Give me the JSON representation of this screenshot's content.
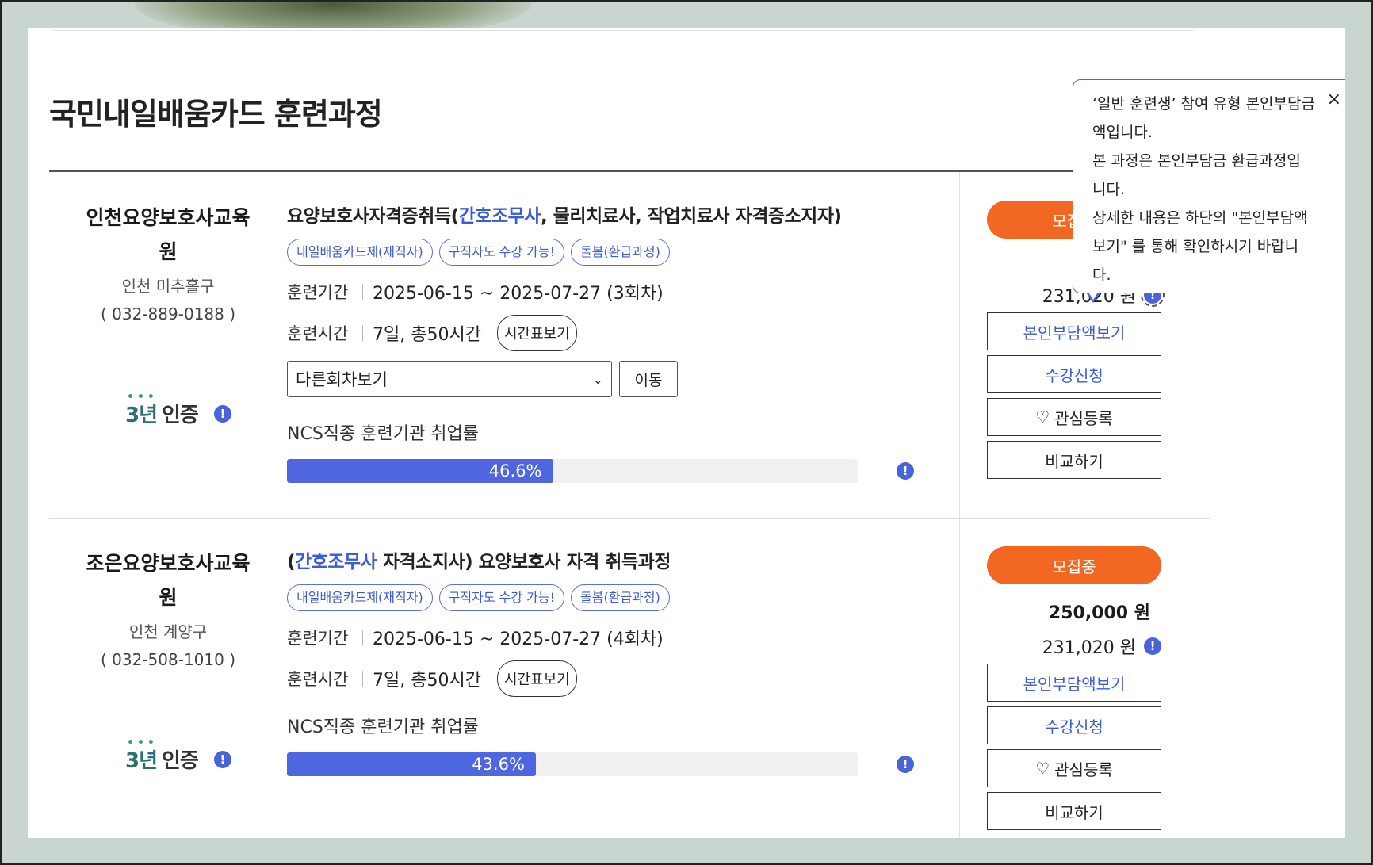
{
  "page": {
    "title": "국민내일배움카드 훈련과정"
  },
  "tooltip": {
    "lines": [
      "‘일반 훈련생’ 참여 유형 본인부담금",
      "액입니다.",
      "본 과정은 본인부담금 환급과정입",
      "니다.",
      "상세한 내용은 하단의 \"본인부담액",
      "보기\" 를 통해 확인하시기 바랍니",
      "다."
    ],
    "close": "×"
  },
  "labels": {
    "period": "훈련기간",
    "hours": "훈련시간",
    "schedule_btn": "시간표보기",
    "other_round": "다른회차보기",
    "move_btn": "이동",
    "ncs": "NCS직종 훈련기관 취업률",
    "status": "모집중",
    "view_cost": "본인부담액보기",
    "apply": "수강신청",
    "wishlist": "관심등록",
    "compare": "비교하기",
    "cert_years": "3년",
    "cert_word": "인증"
  },
  "icons": {
    "info": "info-icon",
    "heart": "heart-icon",
    "chevron": "chevron-down-icon",
    "close": "close-icon"
  },
  "colors": {
    "accent": "#4e66e0",
    "status": "#f26822",
    "link": "#3b5bd9"
  },
  "courses": [
    {
      "inst_name_1": "인천요양보호사교육",
      "inst_name_2": "원",
      "region": "인천 미추홀구",
      "phone": "( 032-889-0188 )",
      "title_pre": "요양보호사자격증취득(",
      "title_hl": "간호조무사",
      "title_post": ", 물리치료사, 작업치료사 자격증소지자)",
      "tags": [
        "내일배움카드제(재직자)",
        "구직자도 수강 가능!",
        "돌봄(환급과정)"
      ],
      "period": "2025-06-15 ~ 2025-07-27 (3회차)",
      "hours": "7일, 총50시간",
      "rate": "46.6%",
      "rate_value": 46.6,
      "price": "",
      "price2": "231,020 원"
    },
    {
      "inst_name_1": "조은요양보호사교육",
      "inst_name_2": "원",
      "region": "인천 계양구",
      "phone": "( 032-508-1010 )",
      "title_pre": "(",
      "title_hl": "간호조무사",
      "title_post": " 자격소지사) 요양보호사 자격 취득과정",
      "tags": [
        "내일배움카드제(재직자)",
        "구직자도 수강 가능!",
        "돌봄(환급과정)"
      ],
      "period": "2025-06-15 ~ 2025-07-27 (4회차)",
      "hours": "7일, 총50시간",
      "rate": "43.6%",
      "rate_value": 43.6,
      "price": "250,000 원",
      "price2": "231,020 원"
    }
  ]
}
